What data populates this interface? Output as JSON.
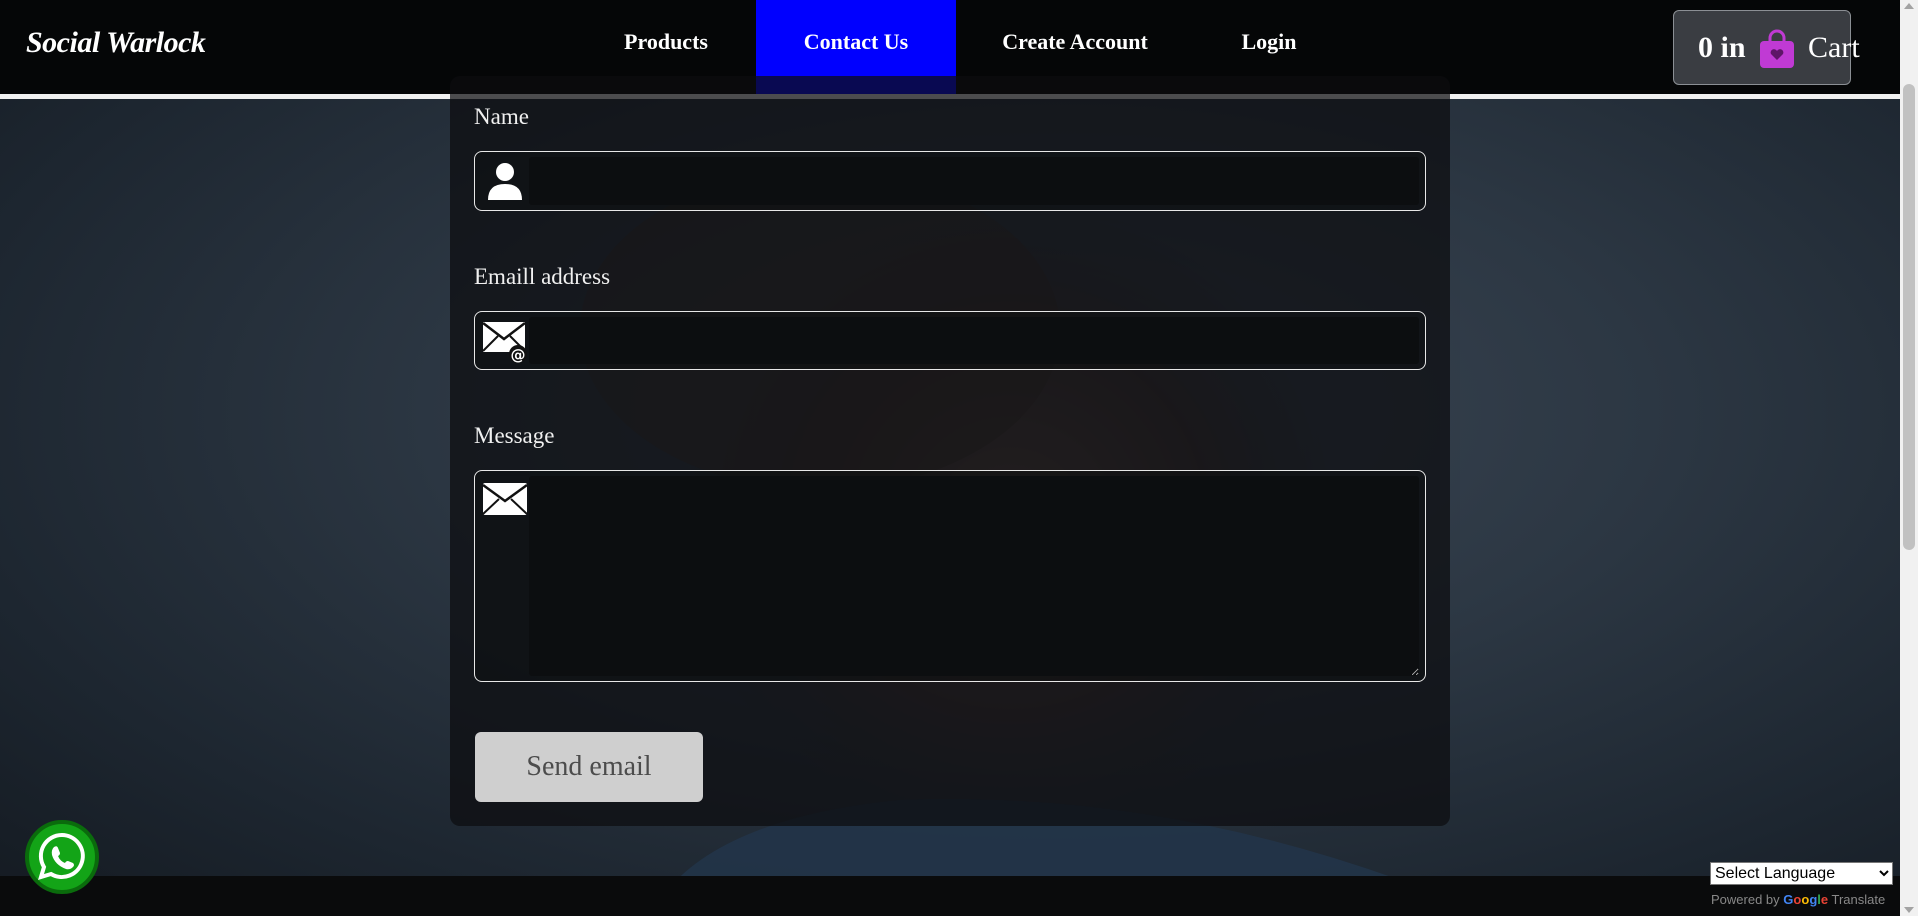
{
  "navbar": {
    "brand": "Social Warlock",
    "items": [
      {
        "label": "Products"
      },
      {
        "label": "Contact Us",
        "active": true
      },
      {
        "label": "Create Account"
      },
      {
        "label": "Login"
      }
    ],
    "cart": {
      "count": "0 in",
      "icon": "shopping-bag-icon",
      "label": "Cart"
    }
  },
  "form": {
    "name_label": "Name",
    "name_value": "",
    "name_icon": "user-icon",
    "email_label": "Emaill address",
    "email_value": "",
    "email_icon": "envelope-at-icon",
    "message_label": "Message",
    "message_value": "",
    "message_icon": "envelope-icon",
    "send_label": "Send email"
  },
  "widgets": {
    "whatsapp_icon": "whatsapp-icon",
    "language_select": "Select Language",
    "powered_by": "Powered by",
    "google": "Google",
    "translate": "Translate"
  },
  "colors": {
    "active_nav": "#0000ff",
    "bag": "#c03ad4",
    "whatsapp": "#13a417"
  }
}
